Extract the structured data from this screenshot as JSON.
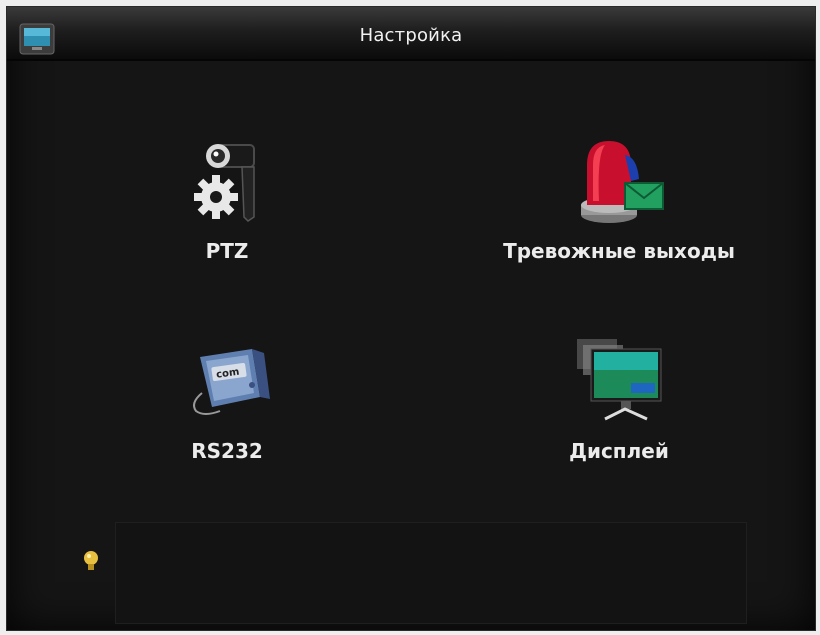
{
  "window": {
    "title": "Настройка",
    "title_icon": "monitor-icon"
  },
  "menu": {
    "items": [
      {
        "label": "PTZ",
        "icon": "ptz-camera-icon"
      },
      {
        "label": "Тревожные выходы",
        "icon": "alarm-siren-icon"
      },
      {
        "label": "RS232",
        "icon": "com-port-icon"
      },
      {
        "label": "Дисплей",
        "icon": "display-monitor-icon"
      }
    ]
  },
  "hint": {
    "icon": "lightbulb-icon",
    "text": ""
  },
  "colors": {
    "background": "#151515",
    "text": "#ececec",
    "accent_green": "#22a060",
    "accent_red": "#c8102e"
  }
}
